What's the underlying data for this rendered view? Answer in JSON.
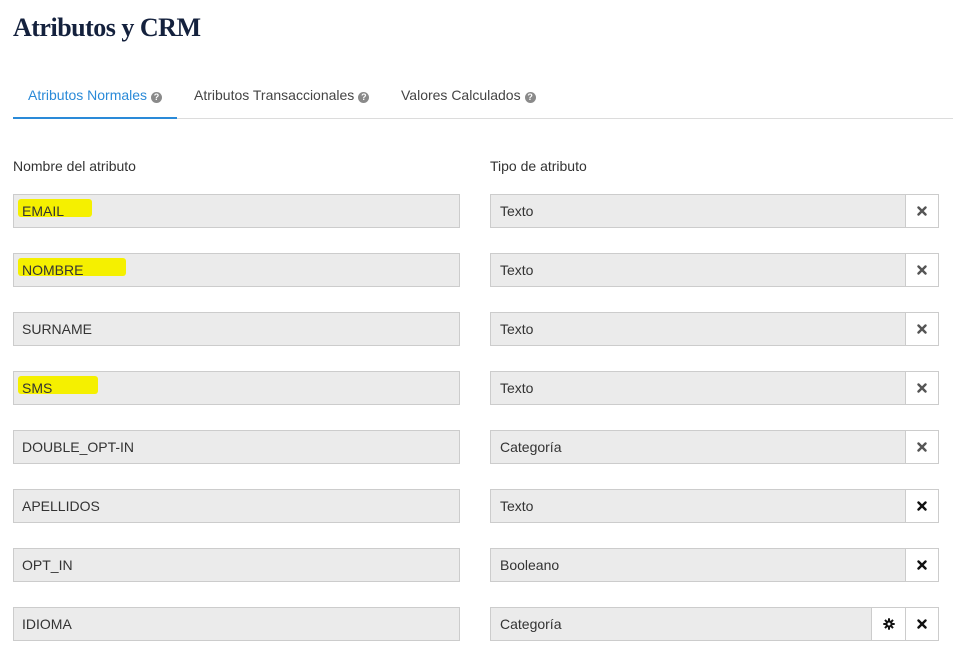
{
  "page": {
    "title": "Atributos y CRM"
  },
  "tabs": [
    {
      "label": "Atributos Normales",
      "active": true
    },
    {
      "label": "Atributos Transaccionales",
      "active": false
    },
    {
      "label": "Valores Calculados",
      "active": false
    }
  ],
  "columns": {
    "name": "Nombre del atributo",
    "type": "Tipo de atributo"
  },
  "rows": [
    {
      "name": "EMAIL",
      "type": "Texto",
      "highlighted": true,
      "actions": [
        "delete"
      ],
      "delete_enabled": false
    },
    {
      "name": "NOMBRE",
      "type": "Texto",
      "highlighted": true,
      "actions": [
        "delete"
      ],
      "delete_enabled": false
    },
    {
      "name": "SURNAME",
      "type": "Texto",
      "highlighted": false,
      "actions": [
        "delete"
      ],
      "delete_enabled": false
    },
    {
      "name": "SMS",
      "type": "Texto",
      "highlighted": true,
      "actions": [
        "delete"
      ],
      "delete_enabled": false
    },
    {
      "name": "DOUBLE_OPT-IN",
      "type": "Categoría",
      "highlighted": false,
      "actions": [
        "delete"
      ],
      "delete_enabled": false
    },
    {
      "name": "APELLIDOS",
      "type": "Texto",
      "highlighted": false,
      "actions": [
        "delete"
      ],
      "delete_enabled": true
    },
    {
      "name": "OPT_IN",
      "type": "Booleano",
      "highlighted": false,
      "actions": [
        "delete"
      ],
      "delete_enabled": true
    },
    {
      "name": "IDIOMA",
      "type": "Categoría",
      "highlighted": false,
      "actions": [
        "settings",
        "delete"
      ],
      "delete_enabled": true
    }
  ],
  "colors": {
    "accent": "#2a8ad8",
    "title": "#14213d",
    "highlight": "#f5f000",
    "field_bg": "#ebebeb",
    "icon_disabled": "#555555",
    "icon_enabled": "#111111"
  },
  "icons": {
    "help": "question-circle-icon",
    "delete": "close-icon",
    "settings": "gear-icon"
  }
}
